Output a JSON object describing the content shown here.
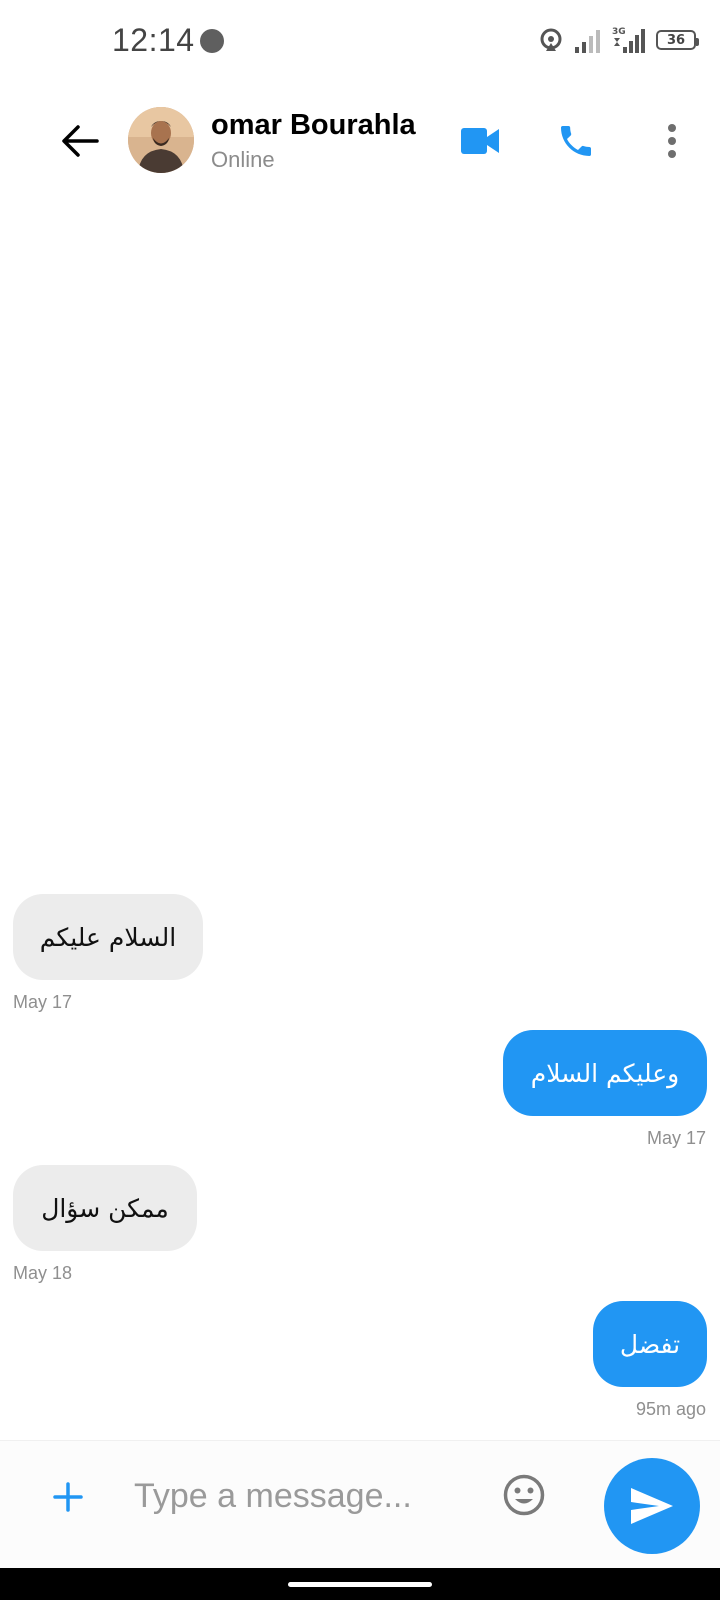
{
  "status_bar": {
    "time": "12:14",
    "battery": "36",
    "network_label": "3G"
  },
  "header": {
    "contact_name": "omar Bourahla",
    "contact_status": "Online"
  },
  "messages": [
    {
      "direction": "incoming",
      "text": "السلام عليكم",
      "time": "May 17"
    },
    {
      "direction": "outgoing",
      "text": "وعليكم السلام",
      "time": "May 17"
    },
    {
      "direction": "incoming",
      "text": "ممكن سؤال",
      "time": "May 18"
    },
    {
      "direction": "outgoing",
      "text": "تفضل",
      "time": "95m ago"
    }
  ],
  "composer": {
    "placeholder": "Type a message...",
    "value": ""
  },
  "colors": {
    "accent": "#2196f3",
    "incoming_bubble": "#ececec",
    "muted_text": "#8f8f8f"
  },
  "icons": {
    "back": "arrow-left-icon",
    "video": "video-camera-icon",
    "call": "phone-icon",
    "more": "more-vertical-icon",
    "attach": "plus-icon",
    "emoji": "emoji-icon",
    "send": "send-icon"
  }
}
